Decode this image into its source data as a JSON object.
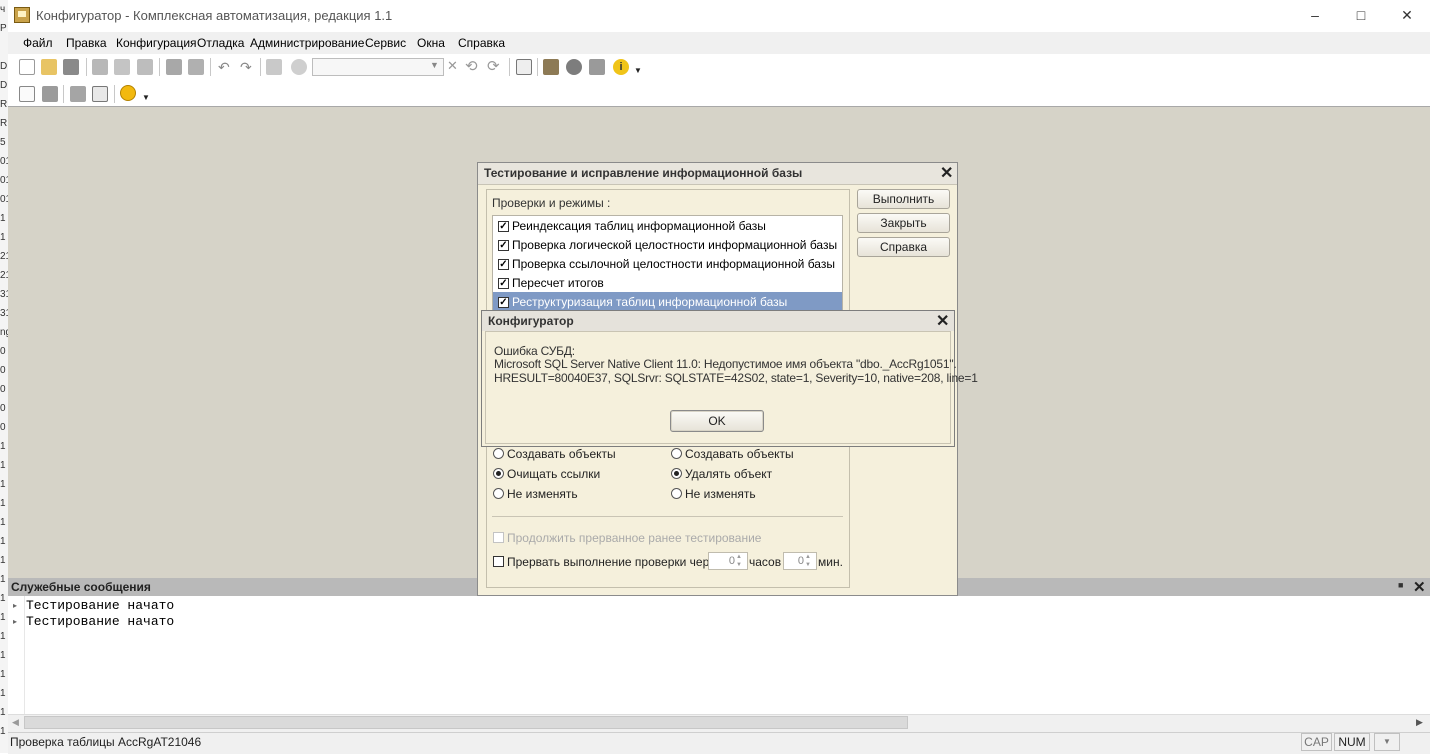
{
  "window": {
    "title": "Конфигуратор - Комплексная автоматизация, редакция 1.1",
    "minimize_icon": "minimize-icon",
    "maximize_icon": "maximize-icon",
    "close_icon": "close-icon"
  },
  "left_strip": [
    "ч",
    "Р",
    "",
    "D",
    "D",
    "R",
    "R",
    "5",
    "01",
    "01",
    "01",
    "1",
    "1",
    "21",
    "21",
    "31",
    "31",
    "ng",
    "0",
    "0",
    "0",
    "0",
    "0",
    "1",
    "1",
    "1",
    "1",
    "1",
    "1",
    "1",
    "1",
    "1",
    "1",
    "1",
    "1",
    "1",
    "1",
    "1",
    "1"
  ],
  "menu": [
    "Файл",
    "Правка",
    "Конфигурация",
    "Отладка",
    "Администрирование",
    "Сервис",
    "Окна",
    "Справка"
  ],
  "toolbar_icons": [
    "new-document-icon",
    "open-folder-icon",
    "save-icon",
    "cut-icon",
    "copy-icon",
    "paste-icon",
    "print-icon",
    "print-preview-icon",
    "undo-icon",
    "redo-icon",
    "find-icon",
    "find-next-icon",
    "search-combo",
    "clear-icon",
    "search-back-icon",
    "search-forward-icon",
    "windows-icon",
    "debug-icon",
    "help-icon",
    "help-index-icon",
    "info-icon"
  ],
  "messages": {
    "title": "Служебные сообщения",
    "pin_icon": "pin-icon",
    "close_icon": "close-icon",
    "lines": [
      "Тестирование начато",
      "Тестирование начато"
    ]
  },
  "status": {
    "text": "Проверка таблицы AccRgAT21046",
    "cap": "CAP",
    "num": "NUM"
  },
  "test_dialog": {
    "title": "Тестирование и исправление информационной базы",
    "buttons": {
      "run": "Выполнить",
      "close": "Закрыть",
      "help": "Справка"
    },
    "checks_label": "Проверки и режимы :",
    "checks": [
      {
        "label": "Реиндексация таблиц информационной базы",
        "checked": true
      },
      {
        "label": "Проверка логической целостности информационной базы",
        "checked": true
      },
      {
        "label": "Проверка ссылочной целостности информационной базы",
        "checked": true
      },
      {
        "label": "Пересчет итогов",
        "checked": true
      },
      {
        "label": "Реструктуризация таблиц информационной базы",
        "checked": true
      }
    ],
    "left_options": [
      {
        "label": "Создавать объекты",
        "selected": false
      },
      {
        "label": "Очищать ссылки",
        "selected": true
      },
      {
        "label": "Не изменять",
        "selected": false
      }
    ],
    "right_options": [
      {
        "label": "Создавать объекты",
        "selected": false
      },
      {
        "label": "Удалять объект",
        "selected": true
      },
      {
        "label": "Не изменять",
        "selected": false
      }
    ],
    "continue_label": "Продолжить прерванное ранее тестирование",
    "interrupt_label": "Прервать выполнение проверки через",
    "hours_value": "0",
    "hours_label": "часов",
    "minutes_value": "0",
    "minutes_label": "мин."
  },
  "error_dialog": {
    "title": "Конфигуратор",
    "line1": "Ошибка СУБД:",
    "line2": "Microsoft SQL Server Native Client 11.0: Недопустимое имя объекта \"dbo._AccRg1051\".",
    "line3": "HRESULT=80040E37, SQLSrvr: SQLSTATE=42S02, state=1, Severity=10, native=208, line=1",
    "ok": "OK"
  }
}
